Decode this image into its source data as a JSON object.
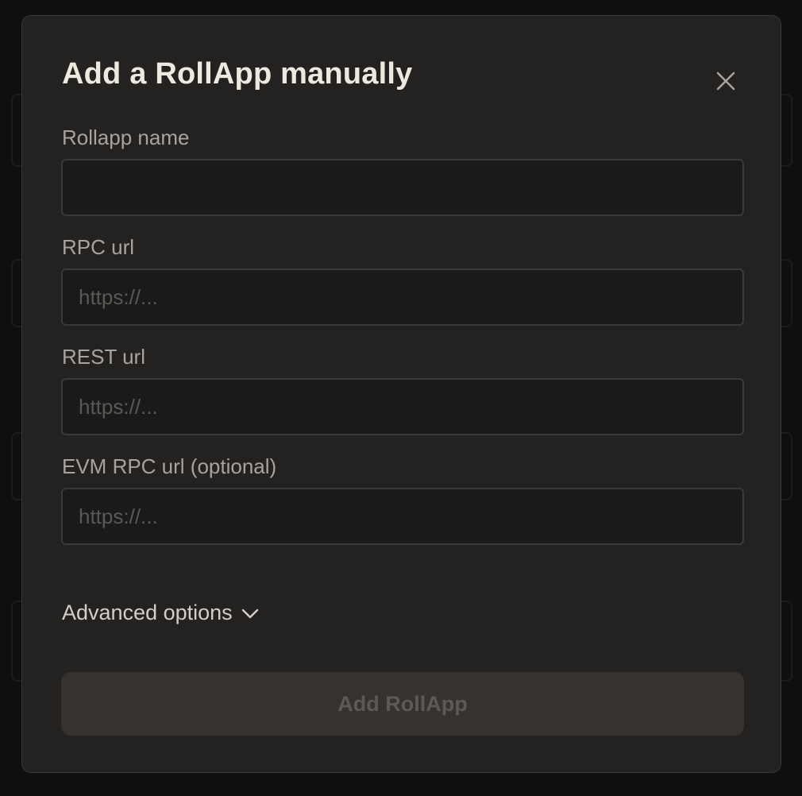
{
  "modal": {
    "title": "Add a RollApp manually",
    "close_icon": "close-icon",
    "fields": [
      {
        "label": "Rollapp name",
        "value": "",
        "placeholder": ""
      },
      {
        "label": "RPC url",
        "value": "",
        "placeholder": "https://..."
      },
      {
        "label": "REST url",
        "value": "",
        "placeholder": "https://..."
      },
      {
        "label": "EVM RPC url (optional)",
        "value": "",
        "placeholder": "https://..."
      }
    ],
    "advanced_options": {
      "label": "Advanced options",
      "icon": "chevron-down-icon"
    },
    "submit_label": "Add RollApp",
    "submit_disabled": true
  },
  "colors": {
    "modal_bg": "#242221",
    "input_bg": "#1b1a1a",
    "title_text": "#efe8df",
    "label_text": "#a9a39c",
    "button_bg_disabled": "#353230",
    "button_text_disabled": "#5d5955"
  }
}
